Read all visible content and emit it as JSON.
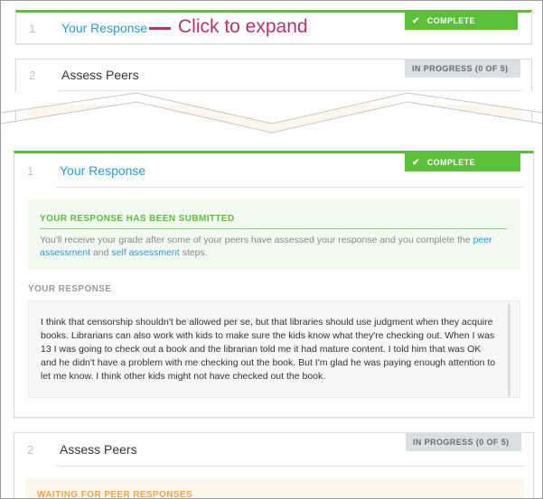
{
  "annotation": {
    "text": "Click to expand",
    "color": "#b5336b"
  },
  "colors": {
    "complete": "#5bbf3a",
    "link": "#2a9bd3",
    "progress_badge": "#dcdfe2",
    "waiting": "#e8a84a"
  },
  "collapsed": {
    "step1": {
      "number": "1",
      "title": "Your Response",
      "status": "COMPLETE",
      "status_icon": "check-icon"
    },
    "step2": {
      "number": "2",
      "title": "Assess Peers",
      "status": "IN PROGRESS (0 OF 5)"
    }
  },
  "expanded": {
    "step1": {
      "number": "1",
      "title": "Your Response",
      "status": "COMPLETE",
      "status_icon": "check-icon",
      "submitted": {
        "title": "YOUR RESPONSE HAS BEEN SUBMITTED",
        "text_before": "You'll receive your grade after some of your peers have assessed your response and you complete the ",
        "link1": "peer assessment",
        "text_middle": " and ",
        "link2": "self assessment",
        "text_after": " steps."
      },
      "response_label": "YOUR RESPONSE",
      "response_text": "I think that censorship shouldn't be allowed per se, but that libraries should use judgment when they acquire books. Librarians can also work with kids to make sure the kids know what they're checking out. When I was 13 I was going to check out a book and the librarian told me it had mature content. I told him that was OK and he didn't have a problem with me checking out the book. But I'm glad he was paying enough attention to let me know. I think other kids might not have checked out the book."
    },
    "step2": {
      "number": "2",
      "title": "Assess Peers",
      "status": "IN PROGRESS (0 OF 5)",
      "waiting": "WAITING FOR PEER RESPONSES"
    }
  }
}
